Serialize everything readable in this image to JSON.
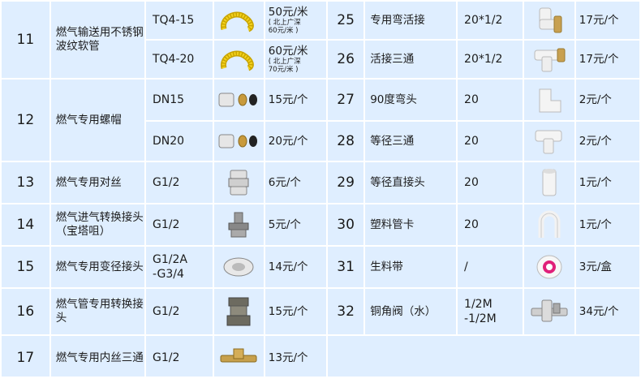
{
  "left_rows": [
    {
      "no": "11",
      "name": "燃气输送用不锈钢波纹软管",
      "specs": [
        "TQ4-15",
        "TQ4-20"
      ],
      "prices": [
        {
          "main": "50元/米",
          "sub1": "( 北上广深",
          "sub2": "60元/米 )"
        },
        {
          "main": "60元/米",
          "sub1": "( 北上广深",
          "sub2": "70元/米 )"
        }
      ],
      "icons": [
        "yellow-hose-icon",
        "yellow-hose-icon"
      ]
    },
    {
      "no": "12",
      "name": "燃气专用螺帽",
      "specs": [
        "DN15",
        "DN20"
      ],
      "prices": [
        {
          "main": "15元/个"
        },
        {
          "main": "20元/个"
        }
      ],
      "icons": [
        "nut-ring-icon",
        "nut-ring-icon"
      ]
    },
    {
      "no": "13",
      "name": "燃气专用对丝",
      "specs": [
        "G1/2"
      ],
      "prices": [
        {
          "main": "6元/个"
        }
      ],
      "icons": [
        "double-nipple-icon"
      ]
    },
    {
      "no": "14",
      "name": "燃气进气转换接头（宝塔咀）",
      "specs": [
        "G1/2"
      ],
      "prices": [
        {
          "main": "5元/个"
        }
      ],
      "icons": [
        "hose-barb-icon"
      ]
    },
    {
      "no": "15",
      "name": "燃气专用变径接头",
      "specs": [
        "G1/2A",
        "-G3/4"
      ],
      "prices": [
        {
          "main": "14元/个"
        }
      ],
      "icons": [
        "reducer-nut-icon"
      ]
    },
    {
      "no": "16",
      "name": "燃气管专用转换接头",
      "specs": [
        "G1/2"
      ],
      "prices": [
        {
          "main": "15元/个"
        }
      ],
      "icons": [
        "hex-union-icon"
      ]
    },
    {
      "no": "17",
      "name": "燃气专用内丝三通",
      "specs": [
        "G1/2"
      ],
      "prices": [
        {
          "main": "13元/个"
        }
      ],
      "icons": [
        "brass-tee-icon"
      ]
    }
  ],
  "right_rows": [
    {
      "no": "25",
      "name": "专用弯活接",
      "spec": "20*1/2",
      "price": "17元/个",
      "icon": "elbow-union-icon"
    },
    {
      "no": "26",
      "name": "活接三通",
      "spec": "20*1/2",
      "price": "17元/个",
      "icon": "union-tee-icon"
    },
    {
      "no": "27",
      "name": "90度弯头",
      "spec": "20",
      "price": "2元/个",
      "icon": "elbow-90-icon"
    },
    {
      "no": "28",
      "name": "等径三通",
      "spec": "20",
      "price": "2元/个",
      "icon": "equal-tee-icon"
    },
    {
      "no": "29",
      "name": "等径直接头",
      "spec": "20",
      "price": "1元/个",
      "icon": "straight-coupling-icon"
    },
    {
      "no": "30",
      "name": "塑料管卡",
      "spec": "20",
      "price": "1元/个",
      "icon": "pipe-clip-icon"
    },
    {
      "no": "31",
      "name": "生料带",
      "spec": "/",
      "price": "3元/盒",
      "icon": "ptfe-tape-icon"
    },
    {
      "no": "32",
      "name": "铜角阀（水）",
      "spec1": "1/2M",
      "spec2": "-1/2M",
      "price": "34元/个",
      "icon": "angle-valve-icon"
    }
  ],
  "colors": {
    "cell": "#dfeeff",
    "grid": "#ffffff",
    "text": "#1b1b1b"
  }
}
